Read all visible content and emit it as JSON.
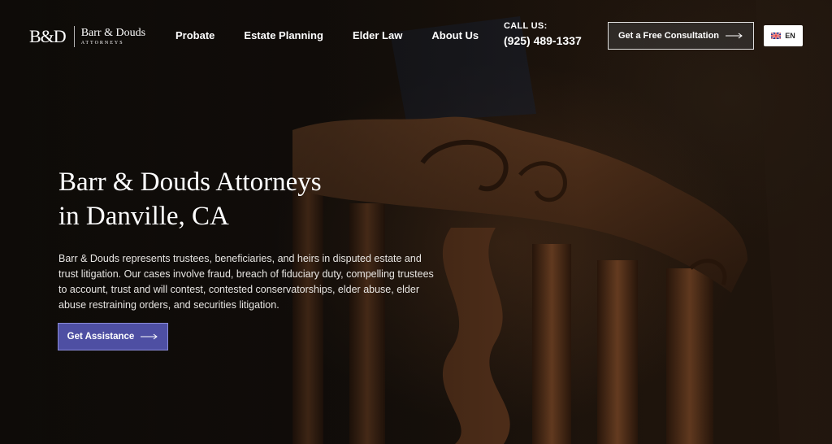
{
  "brand": {
    "monogram": "B&D",
    "name": "Barr & Douds",
    "subtitle": "ATTORNEYS"
  },
  "nav": {
    "items": [
      {
        "label": "Probate"
      },
      {
        "label": "Estate Planning"
      },
      {
        "label": "Elder Law"
      },
      {
        "label": "About Us"
      }
    ]
  },
  "contact": {
    "label": "CALL US:",
    "phone": "(925) 489-1337"
  },
  "header": {
    "cta_label": "Get a Free Consultation",
    "language": "EN"
  },
  "hero": {
    "title_line1": "Barr & Douds Attorneys",
    "title_line2": "in Danville, CA",
    "description": "Barr & Douds represents trustees, beneficiaries, and heirs in disputed estate and trust litigation. Our cases involve fraud, breach of fiduciary duty, compelling trustees to account, trust and will contest, contested conservatorships, elder abuse, elder abuse restraining orders, and securities litigation.",
    "cta_label": "Get Assistance"
  },
  "colors": {
    "accent": "#4e4fa3",
    "background": "#140d08"
  },
  "icons": {
    "arrow": "arrow-right-icon",
    "flag": "uk-flag-icon"
  }
}
